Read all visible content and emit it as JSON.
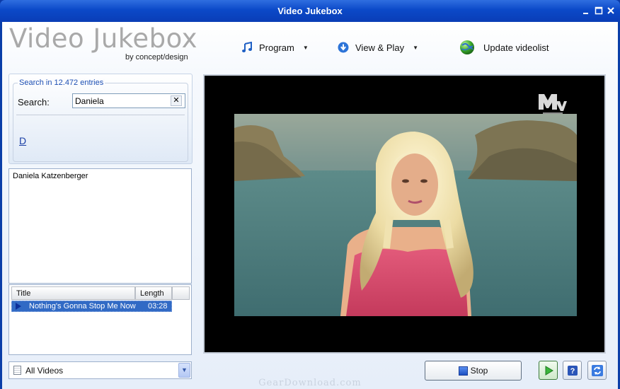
{
  "window": {
    "title": "Video Jukebox"
  },
  "header": {
    "logo_title": "Video Jukebox",
    "logo_subtitle": "by concept/design"
  },
  "menu": {
    "program_label": "Program",
    "view_play_label": "View & Play",
    "update_label": "Update videolist"
  },
  "search": {
    "legend": "Search in 12.472 entries",
    "label": "Search:",
    "value": "Daniela",
    "letter_link": "D"
  },
  "artists": [
    "Daniela Katzenberger"
  ],
  "tracks": {
    "columns": [
      "Title",
      "Length"
    ],
    "rows": [
      {
        "title": "Nothing's Gonna Stop Me Now",
        "length": "03:28"
      }
    ]
  },
  "category": {
    "selected": "All Videos"
  },
  "controls": {
    "stop_label": "Stop"
  },
  "video": {
    "channel_logo": "MTV"
  },
  "watermark": "GearDownload.com",
  "colors": {
    "titlebar": "#0b49c8",
    "selection": "#316ac5",
    "link": "#1b3fa5"
  },
  "icons": {
    "program": "music-note-icon",
    "view_play": "down-arrow-circle-icon",
    "update": "globe-icon",
    "play": "play-icon",
    "help": "help-icon",
    "refresh": "refresh-icon"
  }
}
